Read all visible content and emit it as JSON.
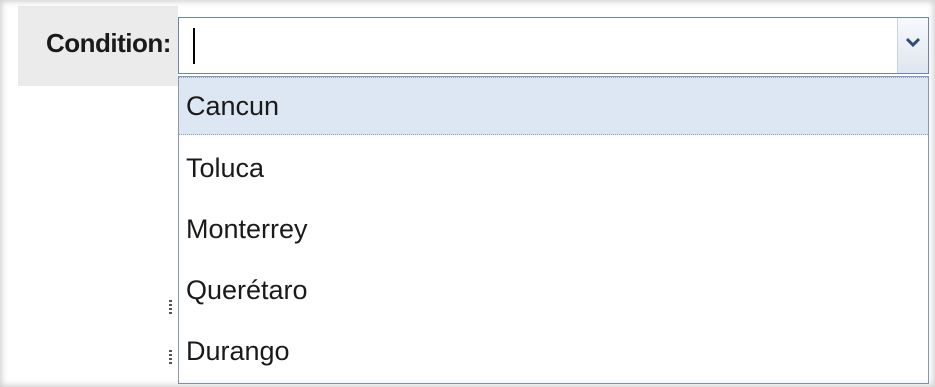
{
  "field": {
    "label": "Condition:",
    "value": "",
    "has_focus": true
  },
  "dropdown_button": {
    "icon": "chevron-down-icon",
    "color": "#2f4a7a"
  },
  "options": [
    {
      "label": "Cancun",
      "highlighted": true
    },
    {
      "label": "Toluca",
      "highlighted": false
    },
    {
      "label": "Monterrey",
      "highlighted": false
    },
    {
      "label": "Querétaro",
      "highlighted": false
    },
    {
      "label": "Durango",
      "highlighted": false
    }
  ],
  "colors": {
    "highlight_bg": "#dde6f3",
    "border": "#6d86b0",
    "label_bg": "#ebebeb"
  }
}
